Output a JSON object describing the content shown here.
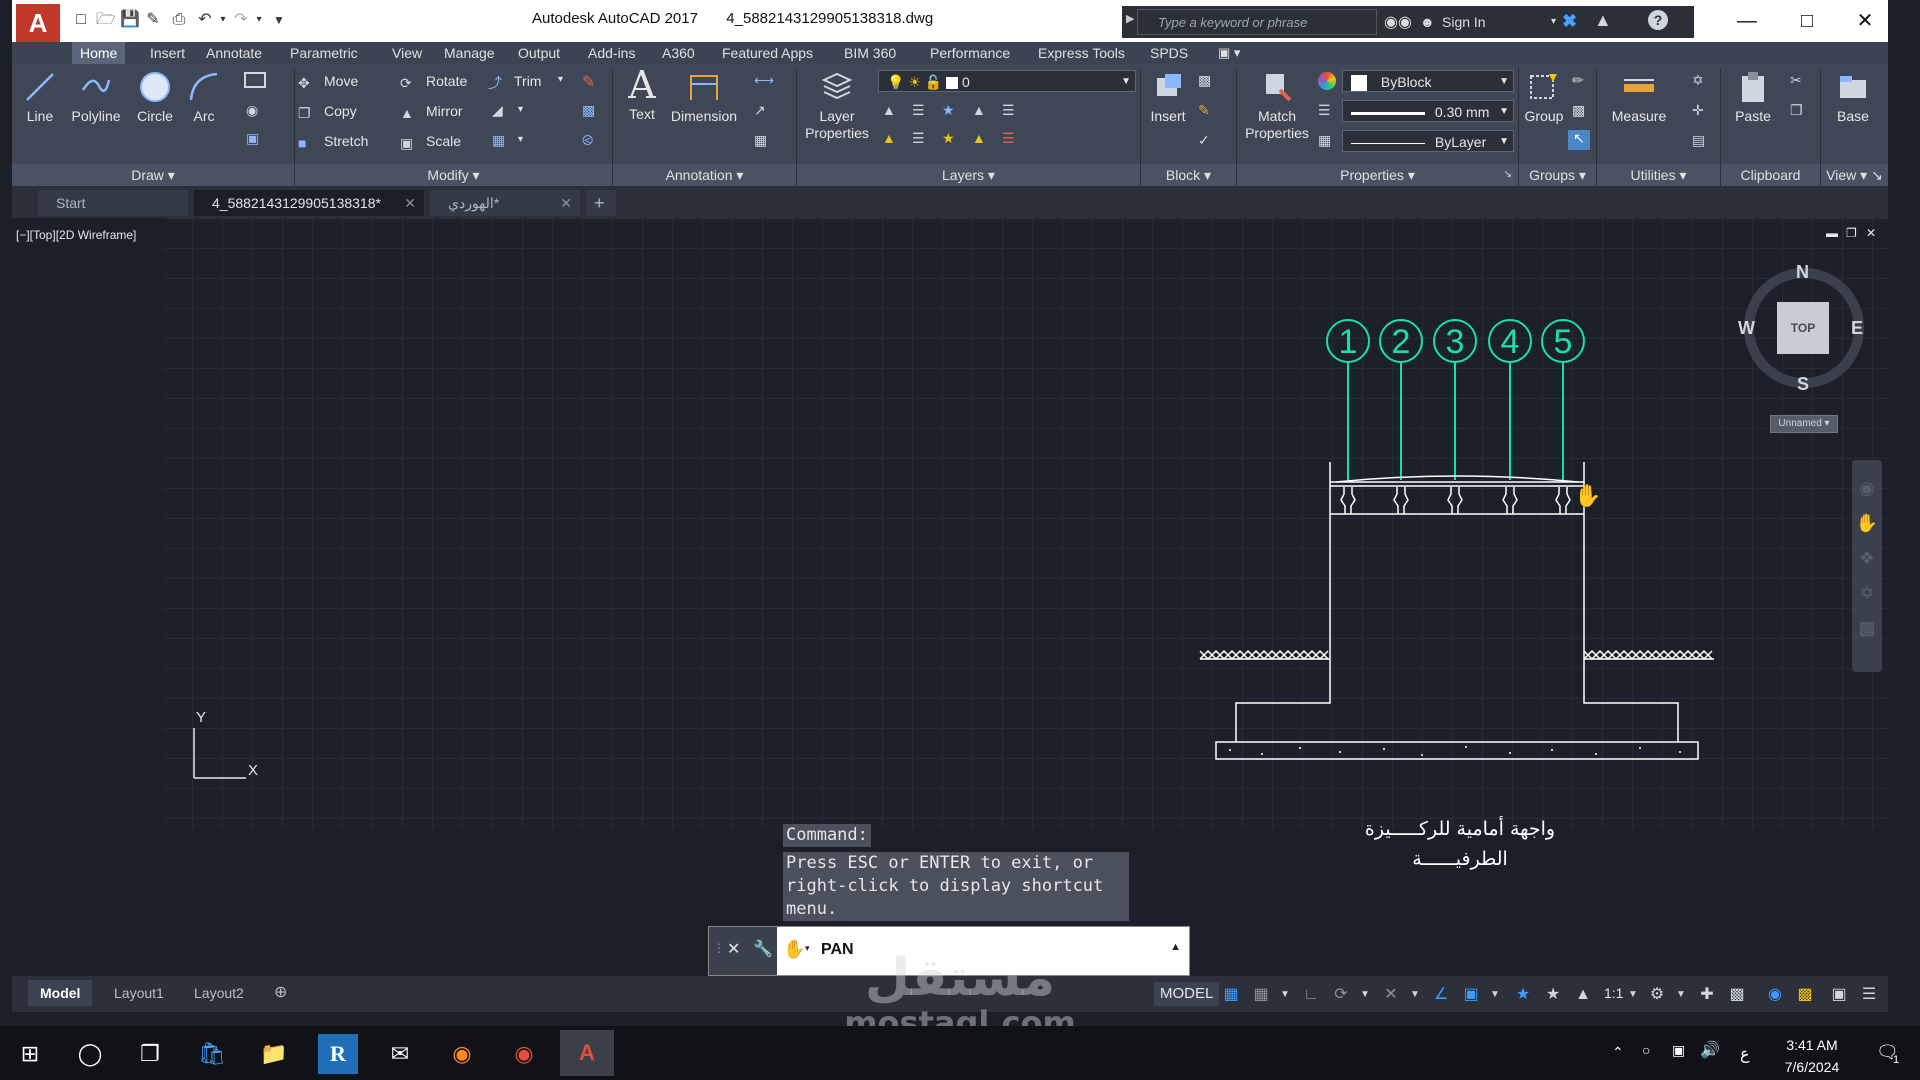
{
  "app": {
    "title": "Autodesk AutoCAD 2017",
    "filename": "4_5882143129905138318.dwg",
    "search_placeholder": "Type a keyword or phrase",
    "signin_label": "Sign In"
  },
  "ribbon_tabs": [
    "Home",
    "Insert",
    "Annotate",
    "Parametric",
    "View",
    "Manage",
    "Output",
    "Add-ins",
    "A360",
    "Featured Apps",
    "BIM 360",
    "Performance",
    "Express Tools",
    "SPDS"
  ],
  "draw": {
    "line": "Line",
    "polyline": "Polyline",
    "circle": "Circle",
    "arc": "Arc",
    "title": "Draw"
  },
  "modify": {
    "move": "Move",
    "rotate": "Rotate",
    "trim": "Trim",
    "copy": "Copy",
    "mirror": "Mirror",
    "stretch": "Stretch",
    "scale": "Scale",
    "title": "Modify"
  },
  "annotation": {
    "text": "Text",
    "dimension": "Dimension",
    "title": "Annotation"
  },
  "layers": {
    "layer_properties": "Layer Properties",
    "current_layer": "0",
    "title": "Layers"
  },
  "block": {
    "insert": "Insert",
    "title": "Block"
  },
  "properties": {
    "match": "Match Properties",
    "color": "ByBlock",
    "lineweight": "0.30 mm",
    "linetype": "ByLayer",
    "title": "Properties"
  },
  "groups": {
    "group": "Group",
    "title": "Groups"
  },
  "utilities": {
    "measure": "Measure",
    "title": "Utilities"
  },
  "clipboard": {
    "paste": "Paste",
    "title": "Clipboard"
  },
  "view": {
    "base": "Base",
    "title": "View"
  },
  "file_tabs": [
    {
      "label": "Start"
    },
    {
      "label": "4_5882143129905138318*"
    },
    {
      "label": "الهوردي*"
    }
  ],
  "viewport_label": "[−][Top][2D Wireframe]",
  "viewcube": {
    "north": "N",
    "south": "S",
    "east": "E",
    "west": "W",
    "face": "TOP",
    "ucs": "Unnamed"
  },
  "ucs": {
    "x": "X",
    "y": "Y"
  },
  "drawing": {
    "axis_labels": [
      "1",
      "2",
      "3",
      "4",
      "5"
    ],
    "caption_line1": "واجهة أمامية للركـــــيزة",
    "caption_line2": "الطرفيــــــة"
  },
  "command": {
    "history_label": "Command:",
    "history_line1": "Press ESC or ENTER to exit, or",
    "history_line2": "right-click to display shortcut",
    "history_line3": "menu.",
    "current": "PAN"
  },
  "layout_tabs": [
    "Model",
    "Layout1",
    "Layout2"
  ],
  "status": {
    "model": "MODEL",
    "scale": "1:1"
  },
  "taskbar": {
    "time": "3:41 AM",
    "date": "7/6/2024",
    "lang": "ع",
    "notifications": "1"
  },
  "watermark": {
    "brand": "مستقل",
    "site": "mostaql.com"
  }
}
